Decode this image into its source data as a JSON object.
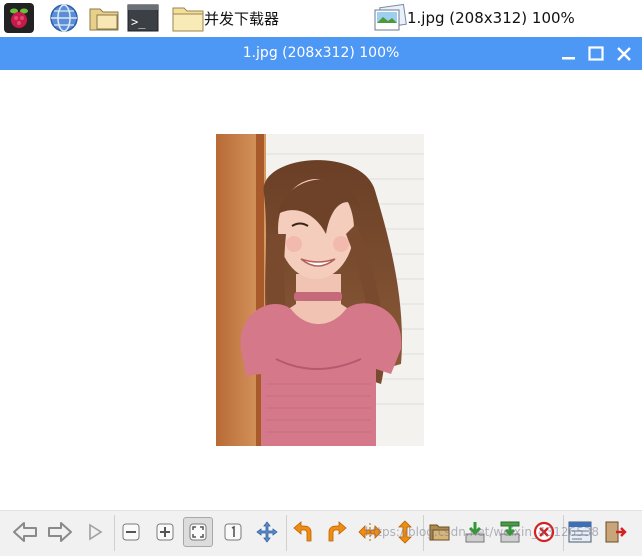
{
  "panel": {
    "folder_label": "并发下载器",
    "task_label": "1.jpg (208x312) 100%"
  },
  "window": {
    "title": "1.jpg (208x312) 100%"
  },
  "watermark": "https://blog.csdn.net/weixin_43126538",
  "colors": {
    "titlebar": "#4d98f5",
    "toolbar_bg": "#f1f1f1",
    "accent_orange": "#f08c10"
  },
  "toolbar": {
    "buttons": [
      "previous-icon",
      "next-icon",
      "slideshow-icon",
      "zoom-out-icon",
      "zoom-in-icon",
      "fit-window-icon",
      "original-size-icon",
      "fullscreen-icon",
      "rotate-left-icon",
      "rotate-right-icon",
      "flip-horizontal-icon",
      "flip-vertical-icon",
      "open-file-icon",
      "save-icon",
      "save-as-icon",
      "delete-icon",
      "preferences-icon",
      "quit-icon"
    ],
    "pressed": "fit-window-icon"
  }
}
